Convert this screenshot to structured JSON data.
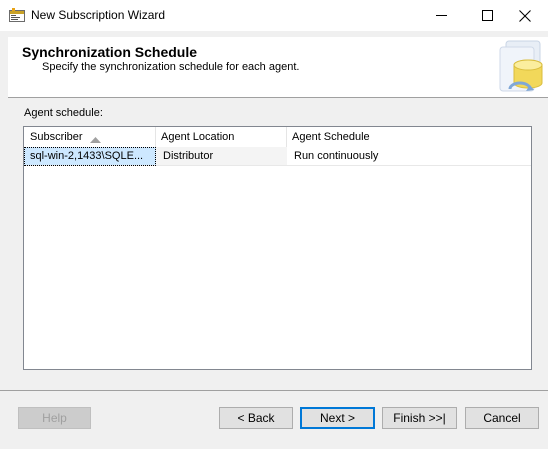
{
  "window": {
    "title": "New Subscription Wizard",
    "minimize_label": "—",
    "maximize_label": "☐",
    "close_label": "✕"
  },
  "header": {
    "title": "Synchronization Schedule",
    "subtitle": "Specify the synchronization schedule for each agent."
  },
  "agent_schedule": {
    "label": "Agent schedule:",
    "columns": [
      "Subscriber",
      "Agent Location",
      "Agent Schedule"
    ],
    "sort_indicator": "▲",
    "rows": [
      [
        "sql-win-2,1433\\SQLE...",
        "Distributor",
        "Run continuously"
      ]
    ]
  },
  "buttons": {
    "help": "Help",
    "back": "< Back",
    "next": "Next >",
    "finish": "Finish >>|",
    "cancel": "Cancel"
  },
  "colors": {
    "accent": "#0078d7",
    "selection": "#cde8ff"
  }
}
